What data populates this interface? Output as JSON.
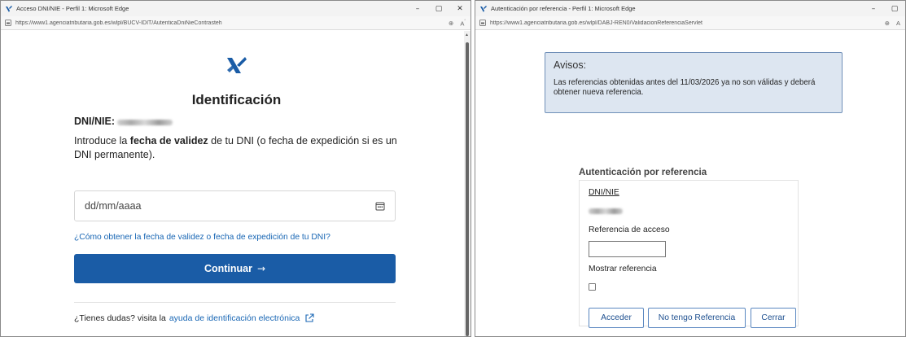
{
  "left_window": {
    "title": "Acceso DNI/NIE - Perfil 1: Microsoft Edge",
    "url": "https://www1.agenciatributaria.gob.es/wlpl/BUCV-IDIT/AutenticaDniNieContrasteh",
    "controls": {
      "minimize": "–",
      "maximize": "▢",
      "close": "✕"
    },
    "page": {
      "heading": "Identificación",
      "dni_label": "DNI/NIE:",
      "intro_before": "Introduce la ",
      "intro_bold": "fecha de validez",
      "intro_after": " de tu DNI (o fecha de expedición si es un DNI permanente).",
      "date_placeholder": "dd/mm/aaaa",
      "help_link": "¿Cómo obtener la fecha de validez o fecha de expedición de tu DNI?",
      "continue_label": "Continuar",
      "continue_arrow": "→",
      "doubts_text": "¿Tienes dudas? visita la",
      "doubts_link": "ayuda de identificación electrónica"
    }
  },
  "right_window": {
    "title": "Autenticación por referencia - Perfil 1: Microsoft Edge",
    "url": "https://www1.agenciatributaria.gob.es/wlpl/DABJ-REN0/ValidacionReferenciaServlet",
    "controls": {
      "minimize": "–",
      "maximize": "▢"
    },
    "page": {
      "notice_title": "Avisos:",
      "notice_text": "Las referencias obtenidas antes del 11/03/2026 ya no son válidas y deberá obtener nueva referencia.",
      "auth_title": "Autenticación por referencia",
      "dni_label": "DNI/NIE",
      "ref_label": "Referencia de acceso",
      "show_ref_label": "Mostrar referencia",
      "buttons": {
        "acceder": "Acceder",
        "no_ref": "No tengo Referencia",
        "cerrar": "Cerrar"
      }
    }
  },
  "colors": {
    "accent": "#1a5ca6",
    "link": "#1866b4",
    "notice_bg": "#dde6f1",
    "notice_border": "#6f8fb8"
  }
}
